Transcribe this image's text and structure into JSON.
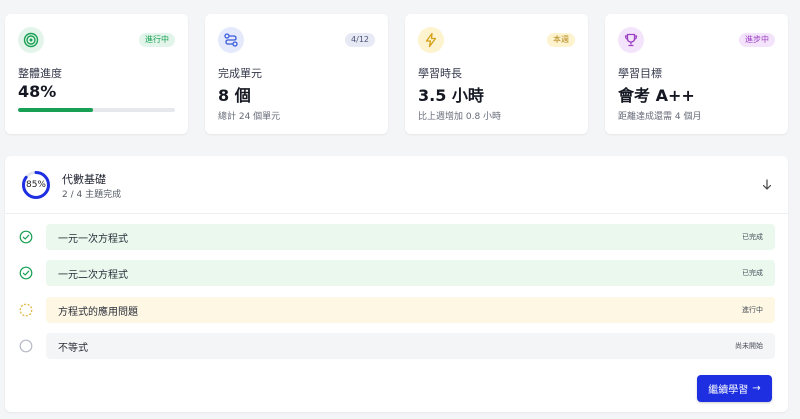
{
  "stats": [
    {
      "icon": "target-icon",
      "badge": "進行中",
      "label": "整體進度",
      "value": "48%",
      "progress_percent": 48,
      "accent": "#18a054"
    },
    {
      "icon": "route-icon",
      "badge": "4/12",
      "label": "完成單元",
      "value": "8 個",
      "sub": "總計 24 個單元",
      "accent": "#3b5bdb"
    },
    {
      "icon": "lightning-icon",
      "badge": "本週",
      "label": "學習時長",
      "value": "3.5 小時",
      "sub": "比上週增加 0.8 小時",
      "accent": "#d4a017"
    },
    {
      "icon": "trophy-icon",
      "badge": "進步中",
      "label": "學習目標",
      "value": "會考 A++",
      "sub": "距離達成還需 4 個月",
      "accent": "#9b3fc4"
    }
  ],
  "topic": {
    "progress_text": "85%",
    "progress_percent": 85,
    "title": "代數基礎",
    "subtitle": "2 / 4 主題完成",
    "items": [
      {
        "name": "一元一次方程式",
        "state": "已完成"
      },
      {
        "name": "一元二次方程式",
        "state": "已完成"
      },
      {
        "name": "方程式的應用問題",
        "state": "進行中"
      },
      {
        "name": "不等式",
        "state": "尚未開始"
      }
    ]
  },
  "cta": {
    "label": "繼續學習",
    "arrow": "→"
  }
}
